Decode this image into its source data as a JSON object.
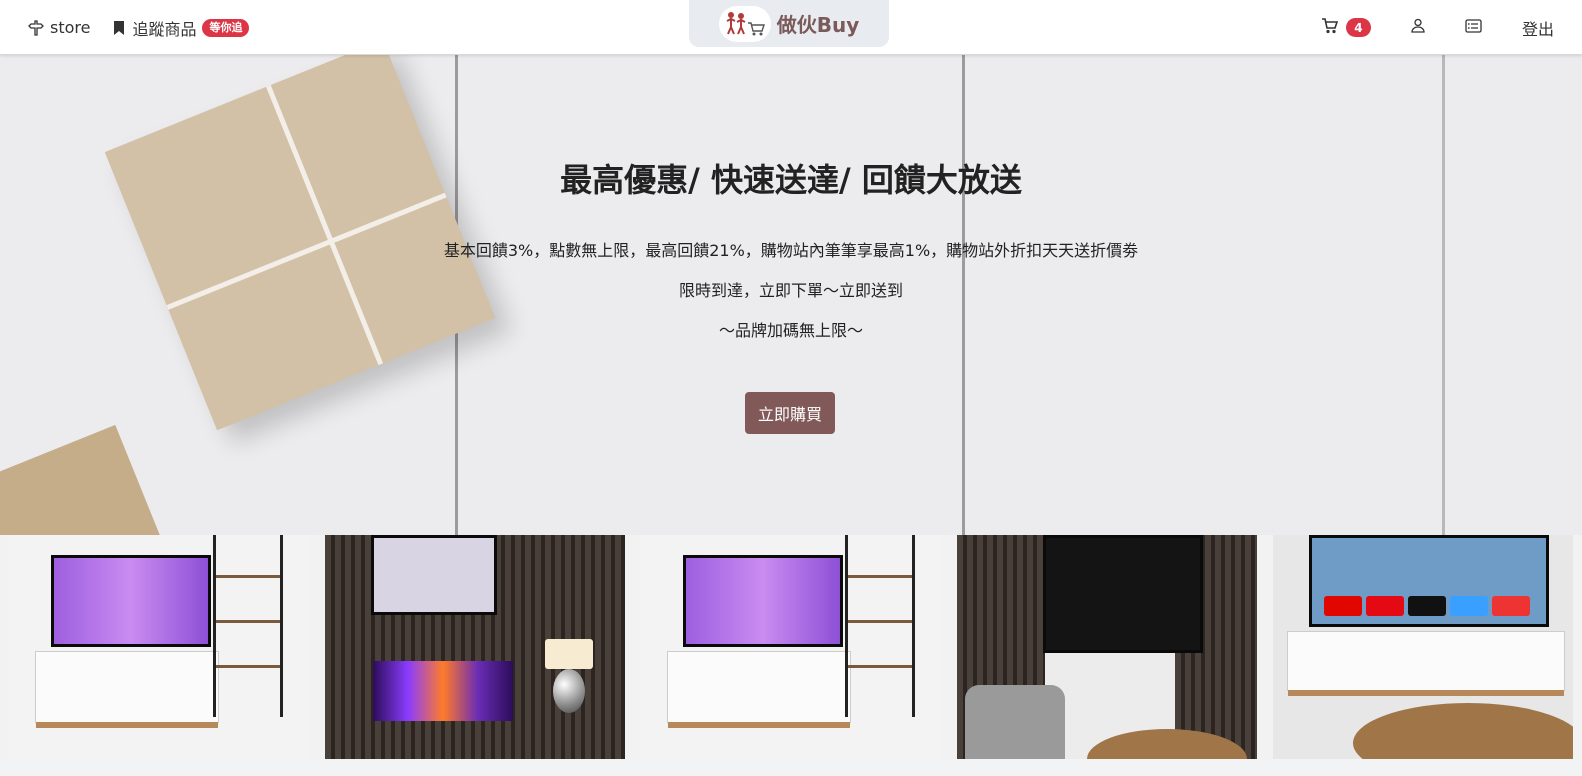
{
  "nav": {
    "store_label": "store",
    "track_label": "追蹤商品",
    "track_badge": "等你追",
    "brand_name": "做伙Buy",
    "cart_count": "4",
    "logout_label": "登出"
  },
  "icons": {
    "store": "signpost-icon",
    "track": "bookmark-icon",
    "cart": "cart-icon",
    "user": "person-icon",
    "orders": "card-list-icon",
    "brand": "family-cart-logo"
  },
  "hero": {
    "title": "最高優惠/ 快速送達/ 回饋大放送",
    "line1": "基本回饋3%，點數無上限，最高回饋21%，購物站內筆筆享最高1%，購物站外折扣天天送折價劵",
    "line2": "限時到達，立即下單～立即送到",
    "line3": "～品牌加碼無上限～",
    "cta_label": "立即購買"
  },
  "colors": {
    "accent": "#825959",
    "badge": "#dc3545",
    "brand_text": "#7b5a5a"
  }
}
